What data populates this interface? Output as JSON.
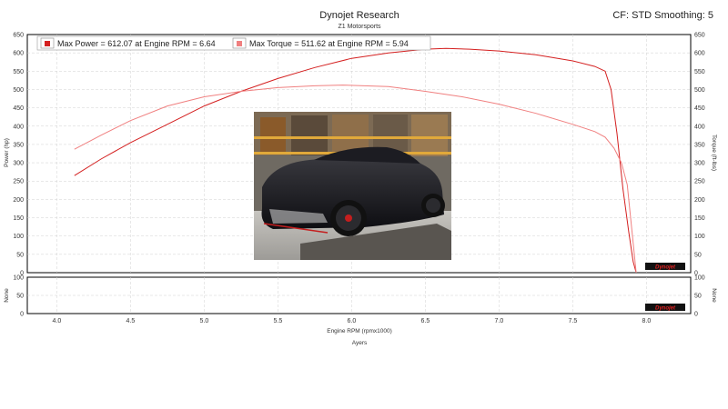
{
  "header": {
    "title": "Dynojet Research",
    "subtitle": "Z1 Motorsports",
    "settings": "CF: STD Smoothing: 5"
  },
  "footer": {
    "label": "Ayers"
  },
  "logo": {
    "text": "Dynojet"
  },
  "colors": {
    "power": "#d42020",
    "torque": "#f08080",
    "grid": "#d0d0d0",
    "axis": "#000000"
  },
  "chart_data": [
    {
      "type": "line",
      "title": "",
      "xlabel": "Engine RPM (rpmx1000)",
      "ylabel": "Power (hp)",
      "y2label": "Torque (ft-lbs)",
      "xlim": [
        3.8,
        8.3
      ],
      "ylim": [
        0,
        650
      ],
      "y2lim": [
        0,
        650
      ],
      "x_ticks": [
        "4.0",
        "4.5",
        "5.0",
        "5.5",
        "6.0",
        "6.5",
        "7.0",
        "7.5",
        "8.0"
      ],
      "y_ticks": [
        "0",
        "50",
        "100",
        "150",
        "200",
        "250",
        "300",
        "350",
        "400",
        "450",
        "500",
        "550",
        "600",
        "650"
      ],
      "grid": true,
      "legend_position": "top-left",
      "series": [
        {
          "name": "Max Power = 612.07 at Engine RPM = 6.64",
          "axis": "left",
          "color": "#d42020",
          "x": [
            4.12,
            4.3,
            4.5,
            4.75,
            5.0,
            5.25,
            5.5,
            5.75,
            6.0,
            6.25,
            6.5,
            6.64,
            6.8,
            7.0,
            7.25,
            7.5,
            7.65,
            7.72,
            7.76,
            7.8,
            7.84,
            7.88,
            7.91,
            7.93
          ],
          "y": [
            265,
            310,
            355,
            405,
            455,
            495,
            530,
            560,
            585,
            600,
            610,
            612,
            610,
            605,
            595,
            578,
            563,
            550,
            500,
            380,
            230,
            110,
            30,
            0
          ]
        },
        {
          "name": "Max Torque = 511.62 at Engine RPM = 5.94",
          "axis": "right",
          "color": "#f08080",
          "x": [
            4.12,
            4.3,
            4.5,
            4.75,
            5.0,
            5.25,
            5.5,
            5.75,
            5.94,
            6.25,
            6.5,
            6.75,
            7.0,
            7.25,
            7.5,
            7.65,
            7.72,
            7.78,
            7.83,
            7.87,
            7.9,
            7.93
          ],
          "y": [
            337,
            375,
            415,
            455,
            480,
            495,
            505,
            510,
            512,
            508,
            495,
            480,
            460,
            435,
            405,
            385,
            370,
            340,
            300,
            240,
            120,
            0
          ]
        }
      ]
    },
    {
      "type": "line",
      "title": "",
      "xlabel": "Engine RPM (rpmx1000)",
      "ylabel": "None",
      "y2label": "None",
      "xlim": [
        3.8,
        8.3
      ],
      "ylim": [
        0,
        100
      ],
      "y2lim": [
        0,
        100
      ],
      "y_ticks": [
        "0",
        "50",
        "100"
      ],
      "grid": true,
      "series": []
    }
  ]
}
